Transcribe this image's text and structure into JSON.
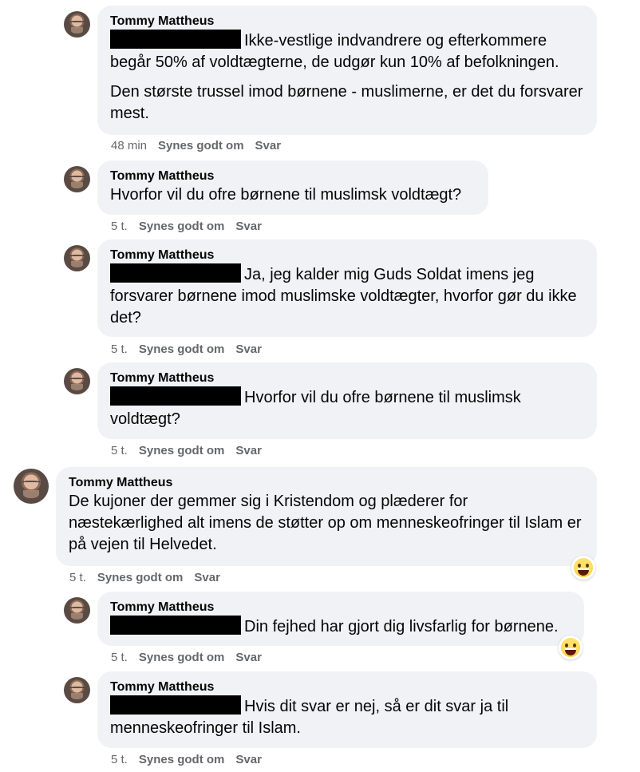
{
  "comments": [
    {
      "author": "Tommy Mattheus",
      "paragraphs": [
        "Ikke-vestlige indvandrere og efterkommere begår 50% af voldtægterne, de udgør kun 10% af befolkningen.",
        "Den største trussel imod børnene - muslimerne, er det du forsvarer mest."
      ],
      "time": "48 min",
      "like": "Synes godt om",
      "reply": "Svar"
    },
    {
      "author": "Tommy Mattheus",
      "paragraphs": [
        "Hvorfor vil du ofre børnene til muslimsk voldtægt?"
      ],
      "time": "5 t.",
      "like": "Synes godt om",
      "reply": "Svar"
    },
    {
      "author": "Tommy Mattheus",
      "paragraphs": [
        "Ja, jeg kalder mig Guds Soldat imens jeg forsvarer børnene imod muslimske voldtægter, hvorfor gør du ikke det?"
      ],
      "time": "5 t.",
      "like": "Synes godt om",
      "reply": "Svar"
    },
    {
      "author": "Tommy Mattheus",
      "paragraphs": [
        "Hvorfor vil du ofre børnene til muslimsk voldtægt?"
      ],
      "time": "5 t.",
      "like": "Synes godt om",
      "reply": "Svar"
    },
    {
      "author": "Tommy Mattheus",
      "paragraphs": [
        "De kujoner der gemmer sig i Kristendom og plæderer for næstekærlighed alt imens de støtter op om menneskeofringer til Islam er på vejen til Helvedet."
      ],
      "time": "5 t.",
      "like": "Synes godt om",
      "reply": "Svar",
      "reaction": "grinning-squinting-face"
    },
    {
      "author": "Tommy Mattheus",
      "paragraphs": [
        "Din fejhed har gjort dig livsfarlig for børnene."
      ],
      "time": "5 t.",
      "like": "Synes godt om",
      "reply": "Svar",
      "reaction": "grinning-squinting-face"
    },
    {
      "author": "Tommy Mattheus",
      "paragraphs": [
        "Hvis dit svar er nej, så er dit svar ja til menneskeofringer til Islam."
      ],
      "time": "5 t.",
      "like": "Synes godt om",
      "reply": "Svar"
    }
  ],
  "colors": {
    "bubble": "#f0f2f5",
    "meta": "#65676b",
    "text": "#050505",
    "redaction": "#000000"
  }
}
